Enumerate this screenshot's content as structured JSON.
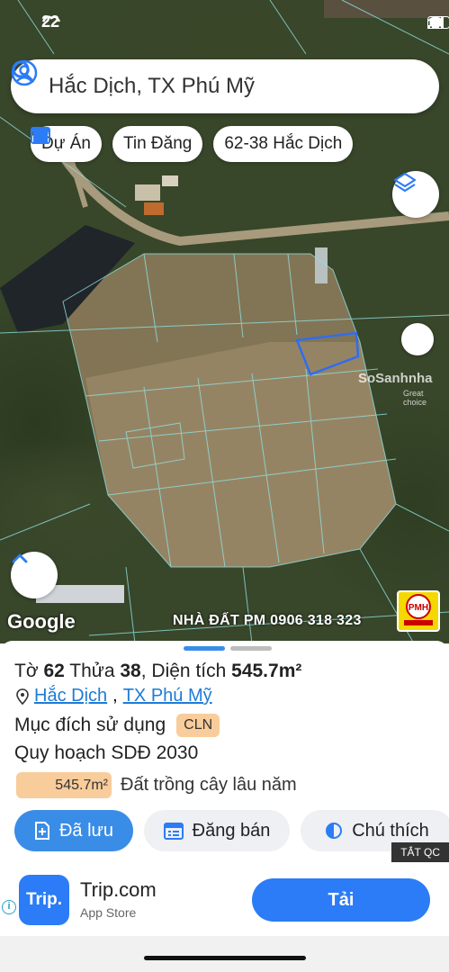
{
  "status_bar": {
    "time": "22"
  },
  "search": {
    "text": "Hắc Dịch, TX Phú Mỹ"
  },
  "chips": [
    {
      "label": "Dự Án",
      "icon": "home-icon"
    },
    {
      "label": "Tin Đăng",
      "icon": "calendar-list-icon"
    },
    {
      "label": "62-38 Hắc Dịch"
    }
  ],
  "map": {
    "google_label": "Google",
    "watermark_site": "SoSanhnha",
    "watermark_tagline": "Great choice",
    "contact_watermark": "NHÀ ĐẤT PM 0906 318 323",
    "logo_text": "PMH"
  },
  "sheet": {
    "title_prefix": "Tờ",
    "to_number": "62",
    "thua_label": "Thửa",
    "thua_number": "38",
    "area_label": "Diện tích",
    "area_value": "545.7m²",
    "location_ward": "Hắc Dịch",
    "location_sep": ",",
    "location_town": "TX Phú Mỹ",
    "purpose_label": "Mục đích sử dụng",
    "purpose_code": "CLN",
    "plan_label": "Quy hoạch SDĐ 2030",
    "plan_area": "545.7m²",
    "plan_desc": "Đất trồng cây lâu năm"
  },
  "actions": [
    {
      "label": "Đã lưu"
    },
    {
      "label": "Đăng bán"
    },
    {
      "label": "Chú thích"
    }
  ],
  "ad": {
    "badge": "TẮT QC",
    "icon_text": "Trip.",
    "app_name": "Trip.com",
    "app_store": "App Store",
    "install": "Tải",
    "info": "i"
  },
  "colors": {
    "accent": "#3a8de6",
    "badge": "#f9cc9b",
    "link": "#1e7bd6"
  }
}
